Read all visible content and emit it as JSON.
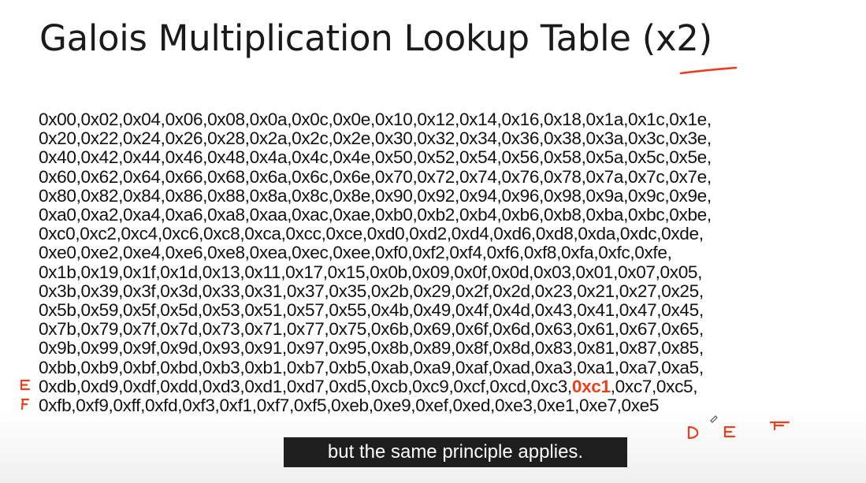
{
  "slide": {
    "title": "Galois Multiplication Lookup Table (x2)",
    "rows_before_highlight": [
      "0x00,0x02,0x04,0x06,0x08,0x0a,0x0c,0x0e,0x10,0x12,0x14,0x16,0x18,0x1a,0x1c,0x1e,",
      "0x20,0x22,0x24,0x26,0x28,0x2a,0x2c,0x2e,0x30,0x32,0x34,0x36,0x38,0x3a,0x3c,0x3e,",
      "0x40,0x42,0x44,0x46,0x48,0x4a,0x4c,0x4e,0x50,0x52,0x54,0x56,0x58,0x5a,0x5c,0x5e,",
      "0x60,0x62,0x64,0x66,0x68,0x6a,0x6c,0x6e,0x70,0x72,0x74,0x76,0x78,0x7a,0x7c,0x7e,",
      "0x80,0x82,0x84,0x86,0x88,0x8a,0x8c,0x8e,0x90,0x92,0x94,0x96,0x98,0x9a,0x9c,0x9e,",
      "0xa0,0xa2,0xa4,0xa6,0xa8,0xaa,0xac,0xae,0xb0,0xb2,0xb4,0xb6,0xb8,0xba,0xbc,0xbe,",
      "0xc0,0xc2,0xc4,0xc6,0xc8,0xca,0xcc,0xce,0xd0,0xd2,0xd4,0xd6,0xd8,0xda,0xdc,0xde,",
      "0xe0,0xe2,0xe4,0xe6,0xe8,0xea,0xec,0xee,0xf0,0xf2,0xf4,0xf6,0xf8,0xfa,0xfc,0xfe,",
      "0x1b,0x19,0x1f,0x1d,0x13,0x11,0x17,0x15,0x0b,0x09,0x0f,0x0d,0x03,0x01,0x07,0x05,",
      "0x3b,0x39,0x3f,0x3d,0x33,0x31,0x37,0x35,0x2b,0x29,0x2f,0x2d,0x23,0x21,0x27,0x25,",
      "0x5b,0x59,0x5f,0x5d,0x53,0x51,0x57,0x55,0x4b,0x49,0x4f,0x4d,0x43,0x41,0x47,0x45,",
      "0x7b,0x79,0x7f,0x7d,0x73,0x71,0x77,0x75,0x6b,0x69,0x6f,0x6d,0x63,0x61,0x67,0x65,",
      "0x9b,0x99,0x9f,0x9d,0x93,0x91,0x97,0x95,0x8b,0x89,0x8f,0x8d,0x83,0x81,0x87,0x85,",
      "0xbb,0xb9,0xbf,0xbd,0xb3,0xb1,0xb7,0xb5,0xab,0xa9,0xaf,0xad,0xa3,0xa1,0xa7,0xa5,"
    ],
    "highlight_row": {
      "before": "0xdb,0xd9,0xdf,0xdd,0xd3,0xd1,0xd7,0xd5,0xcb,0xc9,0xcf,0xcd,0xc3,",
      "highlighted": "0xc1",
      "after": ",0xc7,0xc5,"
    },
    "last_row": "0xfb,0xf9,0xff,0xfd,0xf3,0xf1,0xf7,0xf5,0xeb,0xe9,0xef,0xed,0xe3,0xe1,0xe7,0xe5"
  },
  "caption": {
    "text": "but the same principle applies."
  },
  "colors": {
    "annotation_red": "#e8401c",
    "text": "#111111",
    "caption_bg": "#1e1e1e"
  },
  "annotations": {
    "row_marks": [
      "E",
      "F"
    ],
    "column_marks": [
      "D",
      "E",
      "F"
    ]
  }
}
